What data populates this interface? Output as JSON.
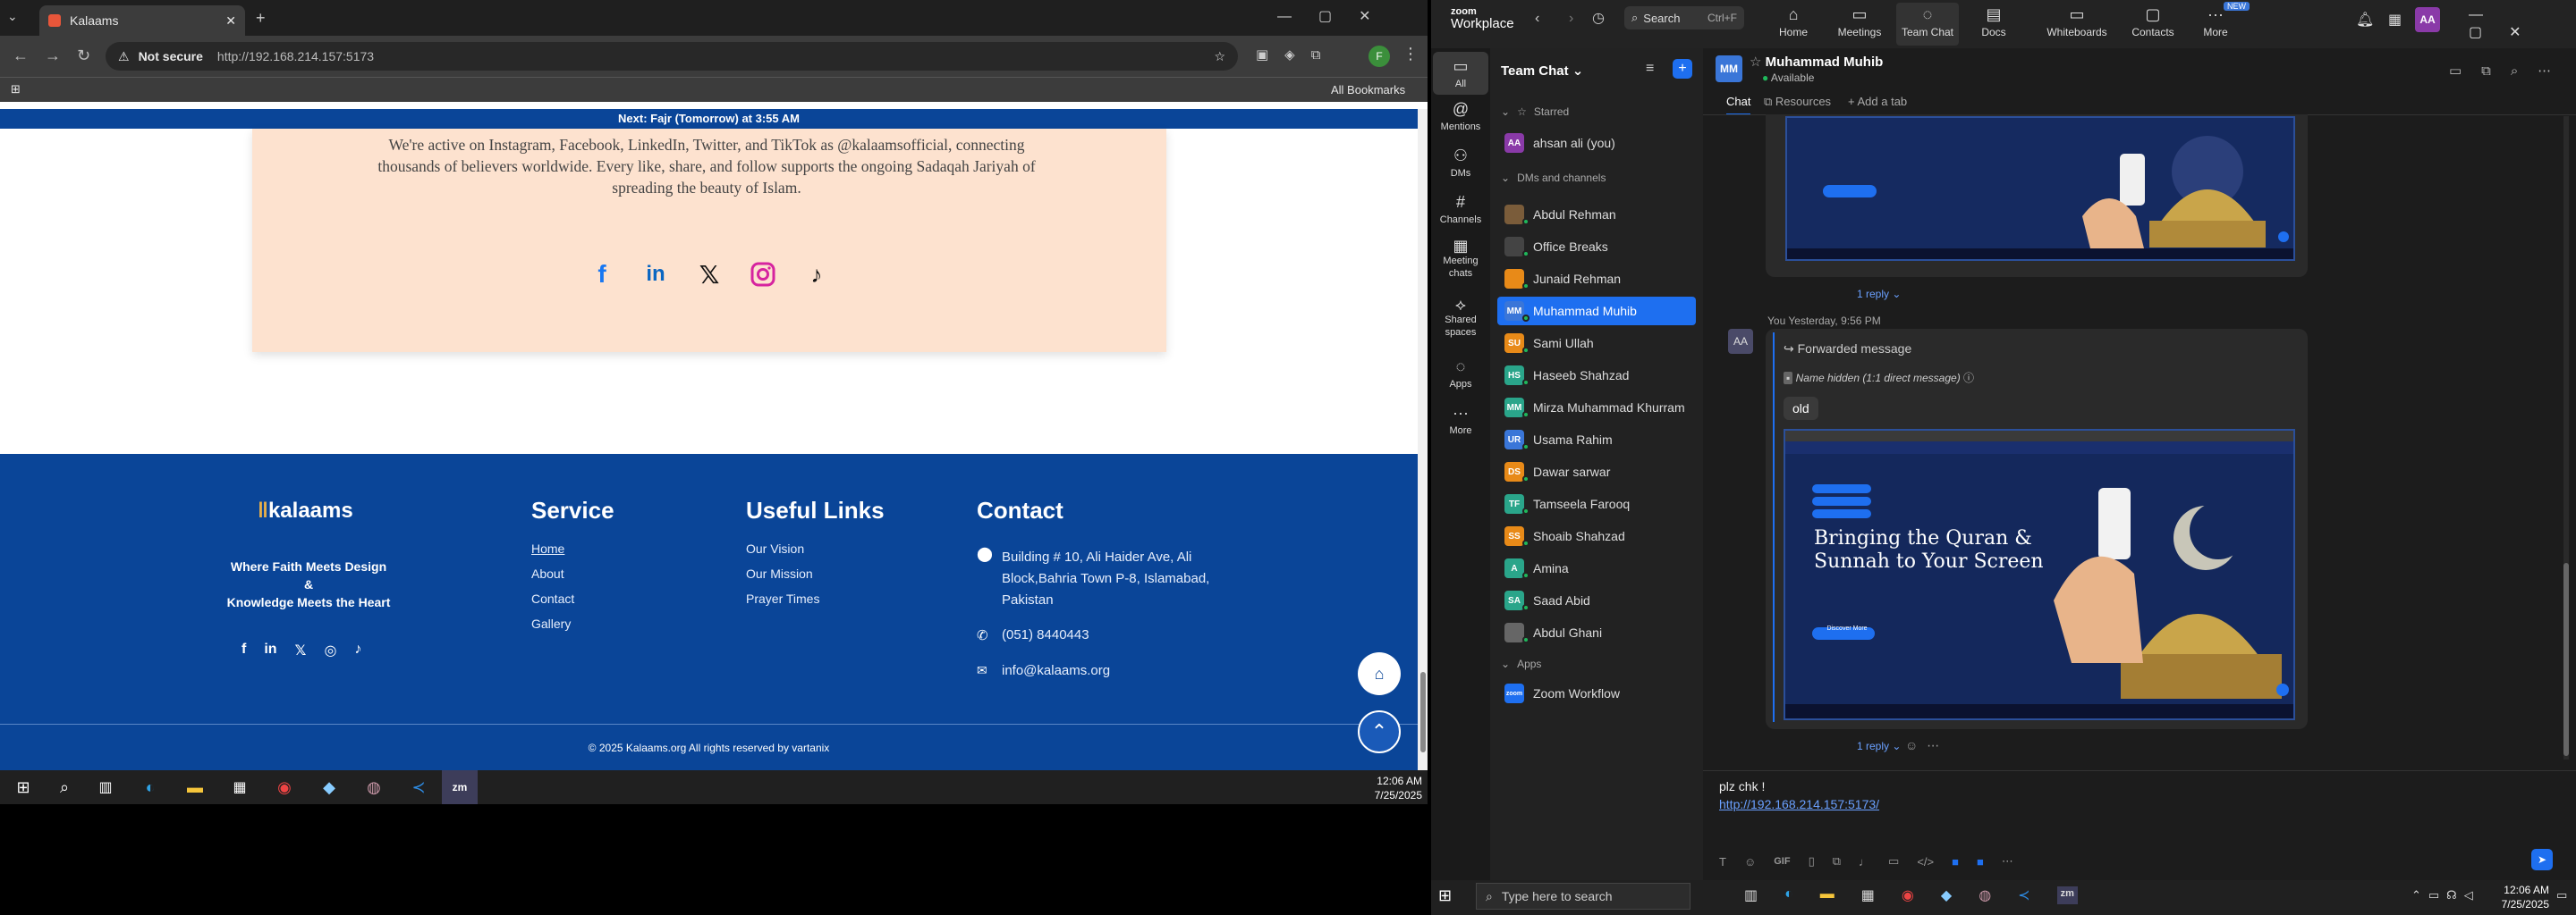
{
  "browser": {
    "tab_title": "Kalaams",
    "not_secure": "Not secure",
    "url": "http://192.168.214.157:5173",
    "all_bookmarks": "All Bookmarks",
    "profile_letter": "F"
  },
  "site": {
    "prayer_banner": "Next: Fajr (Tomorrow) at 3:55 AM",
    "para_line1": "We're active on Instagram, Facebook, LinkedIn, Twitter, and TikTok as @kalaamsofficial, connecting",
    "para_line2": "thousands of believers worldwide. Every like, share, and follow supports the ongoing Sadaqah Jariyah of",
    "para_line3": "spreading the beauty of Islam.",
    "footer": {
      "logo": "kalaams",
      "tagline1": "Where Faith Meets Design",
      "tagline2": "&",
      "tagline3": "Knowledge Meets the Heart",
      "service_title": "Service",
      "service": [
        "Home",
        "About",
        "Contact",
        "Gallery"
      ],
      "useful_title": "Useful Links",
      "useful": [
        "Our Vision",
        "Our Mission",
        "Prayer Times"
      ],
      "contact_title": "Contact",
      "address1": "Building # 10, Ali Haider Ave, Ali",
      "address2": "Block,Bahria Town P-8, Islamabad,",
      "address3": "Pakistan",
      "phone": "(051) 8440443",
      "email": "info@kalaams.org",
      "copyright": "© 2025 Kalaams.org All rights reserved by vartanix"
    }
  },
  "left_taskbar": {
    "time": "12:06 AM",
    "date": "7/25/2025"
  },
  "zoom": {
    "brand_top": "zoom",
    "brand": "Workplace",
    "search": "Search",
    "search_shortcut": "Ctrl+F",
    "top_nav": [
      "Home",
      "Meetings",
      "Team Chat",
      "Docs",
      "Whiteboards",
      "Contacts",
      "More"
    ],
    "new_badge": "NEW",
    "user_initials": "AA",
    "rail": [
      "All",
      "Mentions",
      "DMs",
      "Channels",
      "Meeting chats",
      "Shared spaces",
      "Apps",
      "More"
    ],
    "panel_title": "Team Chat",
    "starred": "Starred",
    "starred_item": "ahsan ali (you)",
    "dms_title": "DMs and channels",
    "dms": [
      {
        "initials": "",
        "name": "Abdul Rehman",
        "color": "#7a5c3a"
      },
      {
        "initials": "",
        "name": "Office Breaks",
        "color": "#444"
      },
      {
        "initials": "",
        "name": "Junaid Rehman",
        "color": "#e88a18"
      },
      {
        "initials": "MM",
        "name": "Muhammad Muhib",
        "color": "#3a76d8"
      },
      {
        "initials": "SU",
        "name": "Sami Ullah",
        "color": "#e88a18"
      },
      {
        "initials": "HS",
        "name": "Haseeb Shahzad",
        "color": "#2aa58a"
      },
      {
        "initials": "MM",
        "name": "Mirza Muhammad Khurram",
        "color": "#2aa58a"
      },
      {
        "initials": "UR",
        "name": "Usama Rahim",
        "color": "#3a76d8"
      },
      {
        "initials": "DS",
        "name": "Dawar sarwar",
        "color": "#e88a18"
      },
      {
        "initials": "TF",
        "name": "Tamseela Farooq",
        "color": "#2aa58a"
      },
      {
        "initials": "SS",
        "name": "Shoaib Shahzad",
        "color": "#e88a18"
      },
      {
        "initials": "A",
        "name": "Amina",
        "color": "#2aa58a"
      },
      {
        "initials": "SA",
        "name": "Saad Abid",
        "color": "#2aa58a"
      },
      {
        "initials": "",
        "name": "Abdul Ghani",
        "color": "#666"
      }
    ],
    "apps_title": "Apps",
    "app_item": "Zoom Workflow",
    "app_icon": "zoom",
    "chat_name": "Muhammad Muhib",
    "chat_status": "Available",
    "tab_chat": "Chat",
    "tab_resources": "Resources",
    "tab_add": "Add a tab",
    "reply1": "1 reply",
    "msg_meta": "You Yesterday, 9:56 PM",
    "forwarded": "Forwarded message",
    "name_hidden": "Name hidden (1:1 direct message)",
    "old": "old",
    "headline1": "Bringing the Quran &",
    "headline2": "Sunnah to Your Screen",
    "discover": "Discover More",
    "reply2": "1 reply",
    "compose_text": "plz chk !",
    "compose_link": "http://192.168.214.157:5173/",
    "gif": "GIF",
    "search_taskbar": "Type here to search",
    "time": "12:06 AM",
    "date": "7/25/2025"
  }
}
